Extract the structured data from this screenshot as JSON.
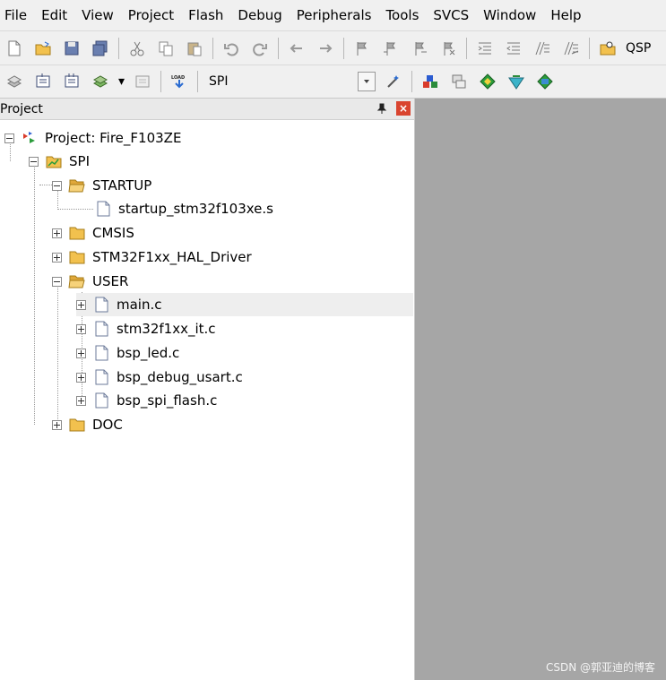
{
  "menubar": {
    "items": [
      "File",
      "Edit",
      "View",
      "Project",
      "Flash",
      "Debug",
      "Peripherals",
      "Tools",
      "SVCS",
      "Window",
      "Help"
    ]
  },
  "toolbar1": {
    "buttons": [
      "new-file-icon",
      "open-file-icon",
      "save-icon",
      "save-all-icon",
      "cut-icon",
      "copy-icon",
      "paste-icon",
      "undo-icon",
      "redo-icon",
      "navigate-back-icon",
      "navigate-forward-icon",
      "bookmark-icon",
      "prev-bookmark-icon",
      "next-bookmark-icon",
      "clear-bookmarks-icon",
      "indent-icon",
      "unindent-icon",
      "comment-icon",
      "uncomment-icon",
      "find-in-files-icon"
    ],
    "trailing_text": "QSP"
  },
  "toolbar2": {
    "buttons": [
      "translate-icon",
      "build-icon",
      "rebuild-icon",
      "batch-build-icon",
      "stop-build-icon"
    ],
    "load_label": "LOAD",
    "target_name": "SPI",
    "right_buttons": [
      "target-options-icon",
      "manage-components-icon",
      "pack-installer-icon",
      "select-packs-icon",
      "run-time-environment-icon",
      "event-recorder-icon"
    ]
  },
  "project_panel": {
    "title": "Project",
    "pin_glyph": "📌",
    "close_glyph": "×"
  },
  "tree": {
    "project_label": "Project: Fire_F103ZE",
    "target_label": "SPI",
    "groups": {
      "startup": "STARTUP",
      "startup_file": "startup_stm32f103xe.s",
      "cmsis": "CMSIS",
      "hal": "STM32F1xx_HAL_Driver",
      "user": "USER",
      "doc": "DOC"
    },
    "user_files": [
      "main.c",
      "stm32f1xx_it.c",
      "bsp_led.c",
      "bsp_debug_usart.c",
      "bsp_spi_flash.c"
    ],
    "selected_file": "main.c"
  },
  "watermark": "CSDN @郭亚迪的博客",
  "colors": {
    "menubar_bg": "#f0f0f0",
    "editor_bg": "#a6a6a6",
    "close_btn": "#d9442f",
    "folder": "#f2c14e",
    "selection_bg": "#eeeeee"
  }
}
